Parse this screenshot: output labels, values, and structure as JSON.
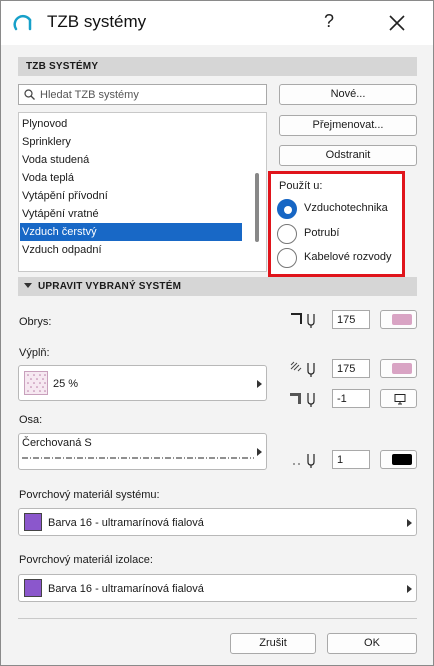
{
  "window": {
    "title": "TZB systémy",
    "help_label": "?"
  },
  "section_systems": {
    "title": "TZB SYSTÉMY"
  },
  "search": {
    "placeholder": "Hledat TZB systémy"
  },
  "buttons": {
    "new": "Nové...",
    "rename": "Přejmenovat...",
    "delete": "Odstranit"
  },
  "systems_list": [
    "Plynovod",
    "Sprinklery",
    "Voda studená",
    "Voda teplá",
    "Vytápění přívodní",
    "Vytápění vratné",
    "Vzduch čerstvý",
    "Vzduch odpadní"
  ],
  "selected_system": "Vzduch čerstvý",
  "use_in": {
    "title": "Použít u:",
    "options": [
      "Vzduchotechnika",
      "Potrubí",
      "Kabelové rozvody"
    ],
    "selected": "Vzduchotechnika"
  },
  "section_edit": {
    "title": "UPRAVIT VYBRANÝ SYSTÉM"
  },
  "outline": {
    "label": "Obrys:",
    "pen": "175",
    "pen_color": "#d9a4c4"
  },
  "fill": {
    "label": "Výplň:",
    "pattern_value": "25 %",
    "fg_pen": "175",
    "fg_pen_color": "#d9a4c4",
    "bg_pen": "-1",
    "bg_icon": "monitor-icon"
  },
  "axis": {
    "label": "Osa:",
    "line_type": "Čerchovaná S",
    "pen": "1",
    "pen_color": "#000000"
  },
  "surface_system": {
    "label": "Povrchový materiál systému:",
    "value": "Barva 16 - ultramarínová fialová",
    "color": "#8b57cc"
  },
  "surface_insulation": {
    "label": "Povrchový materiál izolace:",
    "value": "Barva 16 - ultramarínová fialová",
    "color": "#8b57cc"
  },
  "footer": {
    "cancel": "Zrušit",
    "ok": "OK"
  },
  "colors": {
    "accent": "#1766c4",
    "highlight_border": "#e0141b"
  }
}
